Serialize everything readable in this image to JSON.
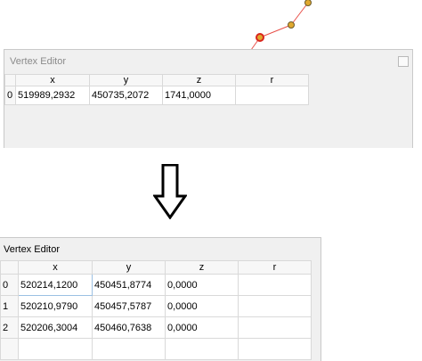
{
  "top_editor": {
    "title": "Vertex Editor",
    "columns": [
      "",
      "x",
      "y",
      "z",
      "r"
    ],
    "rows": [
      {
        "index": "0",
        "x": "519989,2932",
        "y": "450735,2072",
        "z": "1741,0000",
        "r": ""
      }
    ]
  },
  "bottom_editor": {
    "title": "Vertex Editor",
    "columns": [
      "",
      "x",
      "y",
      "z",
      "r"
    ],
    "rows": [
      {
        "index": "0",
        "x": "520214,1200",
        "y": "450451,8774",
        "z": "0,0000",
        "r": ""
      },
      {
        "index": "1",
        "x": "520210,9790",
        "y": "450457,5787",
        "z": "0,0000",
        "r": ""
      },
      {
        "index": "2",
        "x": "520206,3004",
        "y": "450460,7638",
        "z": "0,0000",
        "r": ""
      }
    ]
  },
  "colors": {
    "vertex_fill": "#e0a82e",
    "selected_vertex_ring": "#d9251d",
    "edge_line": "#e8504a"
  },
  "icons": {
    "arrow": "down-arrow-icon"
  }
}
